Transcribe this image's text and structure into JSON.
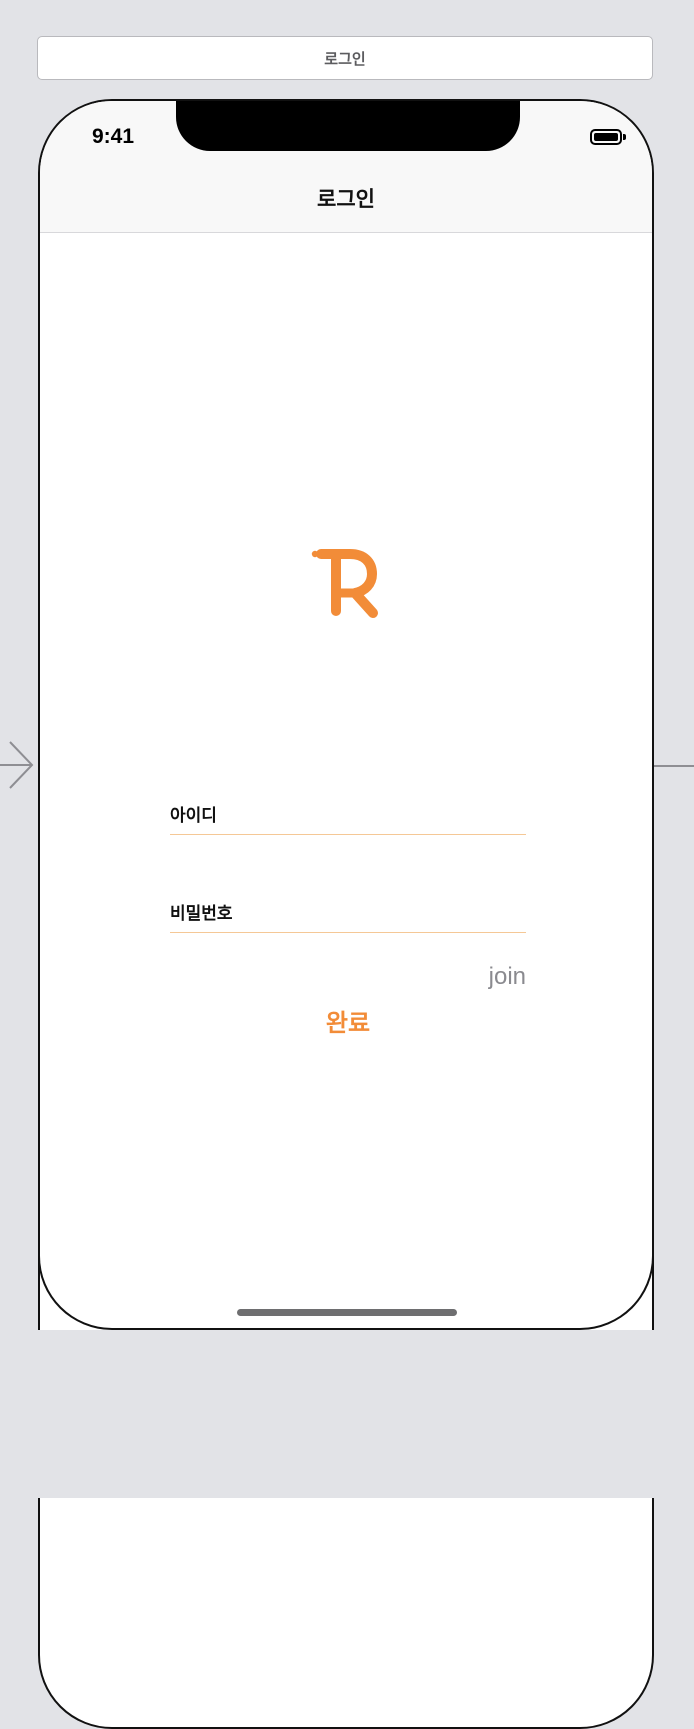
{
  "scene": {
    "title": "로그인"
  },
  "status_bar": {
    "time": "9:41",
    "battery_icon": "battery-full-icon"
  },
  "nav_bar": {
    "title": "로그인"
  },
  "logo": {
    "icon": "r-logo-icon",
    "color": "#f28c38"
  },
  "form": {
    "id_field": {
      "placeholder": "아이디",
      "value": ""
    },
    "password_field": {
      "placeholder": "비밀번호",
      "value": ""
    },
    "join_label": "join",
    "done_label": "완료"
  },
  "colors": {
    "accent": "#f28c38",
    "field_underline": "#f5c896",
    "canvas_background": "#e2e3e7",
    "join_text": "#8a8a8f"
  }
}
